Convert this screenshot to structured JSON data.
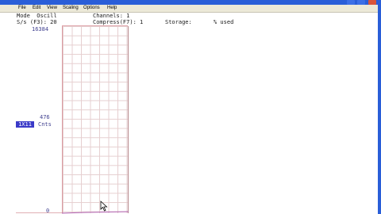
{
  "menu": {
    "items": [
      "File",
      "Edit",
      "View",
      "Scaling",
      "Options",
      "Help"
    ]
  },
  "info": {
    "mode_label": "Mode  Oscill",
    "channels_label": "Channels: 1",
    "rate_label": "S/s (F3): 20",
    "compress_label": "Compress(F7): 1",
    "storage_label": "Storage:",
    "storage_used": "% used"
  },
  "axis": {
    "y_top": "16384",
    "y_mid": "476",
    "y_bottom": "0",
    "scale_badge": "1X11",
    "unit": "Cnts"
  },
  "colors": {
    "titlebar": "#2a5ed8",
    "menubar": "#ece9d8",
    "grid": "#e6cfd0",
    "trace": "#b060b0",
    "badge": "#3a3ac8"
  }
}
